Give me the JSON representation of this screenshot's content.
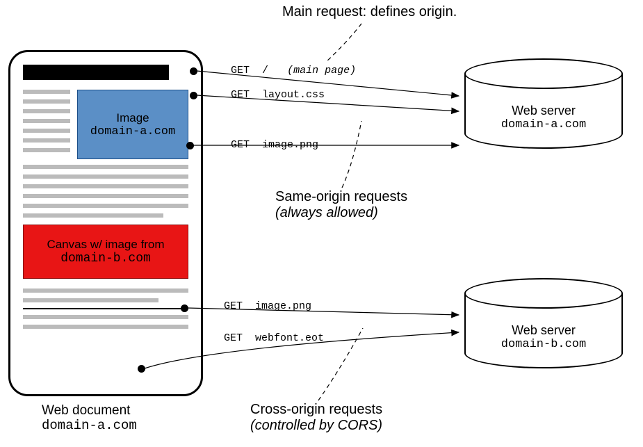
{
  "annotations": {
    "main_request": "Main request: defines origin.",
    "same_origin_line1": "Same-origin requests",
    "same_origin_line2": "(always allowed)",
    "cross_origin_line1": "Cross-origin requests",
    "cross_origin_line2": "(controlled by CORS)"
  },
  "document": {
    "caption_line1": "Web document",
    "caption_domain": "domain-a.com",
    "image_label": "Image",
    "image_domain": "domain-a.com",
    "canvas_label": "Canvas w/ image from",
    "canvas_domain": "domain-b.com"
  },
  "requests": {
    "r1_method": "GET",
    "r1_path": "/",
    "r1_note": "(main page)",
    "r2_method": "GET",
    "r2_path": "layout.css",
    "r3_method": "GET",
    "r3_path": "image.png",
    "r4_method": "GET",
    "r4_path": "image.png",
    "r5_method": "GET",
    "r5_path": "webfont.eot"
  },
  "servers": {
    "a_label": "Web server",
    "a_domain": "domain-a.com",
    "b_label": "Web server",
    "b_domain": "domain-b.com"
  }
}
